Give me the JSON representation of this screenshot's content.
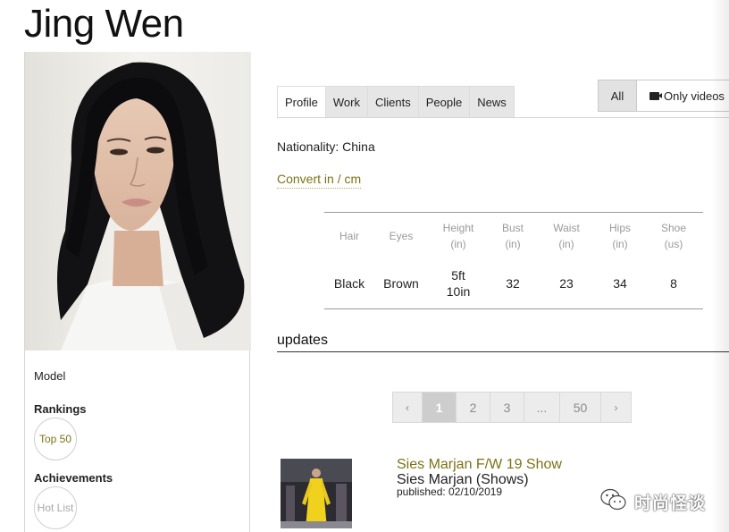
{
  "profile": {
    "name": "Jing Wen"
  },
  "sidebar": {
    "role": "Model",
    "rankings_heading": "Rankings",
    "ranking_badge": "Top 50",
    "achievements_heading": "Achievements",
    "achievement_badge": "Hot List"
  },
  "tabs": [
    "Profile",
    "Work",
    "Clients",
    "People",
    "News"
  ],
  "active_tab": "Profile",
  "media_filter": {
    "all": "All",
    "videos": "Only videos",
    "videos_icon": "video-camera-icon"
  },
  "details": {
    "nationality": "Nationality: China",
    "convert_link": "Convert in / cm"
  },
  "measurements": {
    "headers": [
      {
        "label": "Hair",
        "unit": ""
      },
      {
        "label": "Eyes",
        "unit": ""
      },
      {
        "label": "Height",
        "unit": "(in)"
      },
      {
        "label": "Bust",
        "unit": "(in)"
      },
      {
        "label": "Waist",
        "unit": "(in)"
      },
      {
        "label": "Hips",
        "unit": "(in)"
      },
      {
        "label": "Shoe",
        "unit": "(us)"
      }
    ],
    "values": [
      "Black",
      "Brown",
      "5ft 10in",
      "32",
      "23",
      "34",
      "8"
    ]
  },
  "updates": {
    "heading": "updates"
  },
  "pagination": {
    "prev": "‹",
    "pages": [
      "1",
      "2",
      "3",
      "...",
      "50"
    ],
    "next": "›",
    "current": "1"
  },
  "news_item": {
    "title": "Sies Marjan F/W 19 Show",
    "subtitle": "Sies Marjan (Shows)",
    "published": "published: 02/10/2019"
  },
  "watermark": {
    "text": "时尚怪谈"
  },
  "colors": {
    "accent_gold": "#7d7217",
    "tab_inactive": "#e6e6e6",
    "pager_active": "#cdcdcd"
  }
}
